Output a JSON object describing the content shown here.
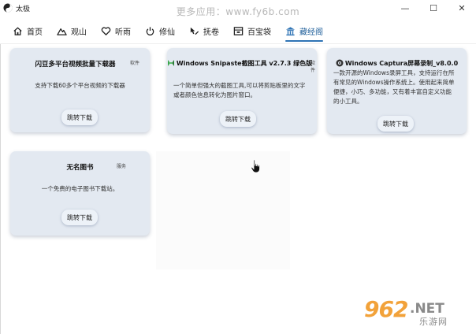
{
  "window": {
    "title": "太极",
    "controls": {
      "minimize": "—",
      "maximize": "☐",
      "close": "✕"
    }
  },
  "watermark": "更多应用：www.fy6b.com",
  "tabs": [
    {
      "label": "首页",
      "icon": "home-icon",
      "active": false
    },
    {
      "label": "观山",
      "icon": "mountain-icon",
      "active": false
    },
    {
      "label": "听雨",
      "icon": "heart-icon",
      "active": false
    },
    {
      "label": "修仙",
      "icon": "power-icon",
      "active": false
    },
    {
      "label": "抚卷",
      "icon": "cursor-pencil-icon",
      "active": false
    },
    {
      "label": "百宝袋",
      "icon": "inbox-icon",
      "active": false
    },
    {
      "label": "藏经阁",
      "icon": "temple-icon",
      "active": true
    }
  ],
  "cards": [
    {
      "title": "闪豆多平台视频批量下载器",
      "tag": "软件",
      "description": "支持下载60多个平台视频的下载器",
      "button": "跳转下载"
    },
    {
      "title": "Windows Snipaste截图工具 v2.7.3 绿色版",
      "tag": "软件",
      "description": "一个简单但强大的截图工具,可以将剪贴板里的文字或者颜色信息转化为图片窗口。",
      "button": "跳转下载",
      "icon": "snipaste-icon"
    },
    {
      "title": "Windows Captura屏幕录制_v8.0.0",
      "tag": "",
      "description": "一款开源的Windows录屏工具，支持运行在所有常见的Windows操作系统上。使用起来简单便捷，小巧、多功能，又有着丰富自定义功能的小工具。",
      "button": "跳转下载",
      "icon": "captura-icon"
    },
    {
      "title": "无名图书",
      "tag": "服务",
      "description": "一个免费的电子图书下载站。",
      "button": "跳转下载"
    }
  ],
  "brand": {
    "number": "962",
    "suffix": ".NET",
    "chinese": "乐游网"
  },
  "colors": {
    "accent": "#2f74b5",
    "card_bg": "#e3e9f1",
    "brand_orange": "#f2a23a"
  }
}
